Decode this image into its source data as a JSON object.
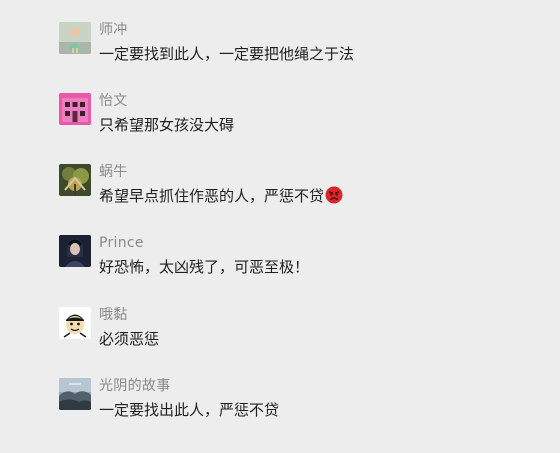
{
  "comments": [
    {
      "nickname": "师冲",
      "text": "一定要找到此人，一定要把他绳之于法",
      "avatar_icon": "child-photo-icon"
    },
    {
      "nickname": "怡文",
      "text": "只希望那女孩没大碍",
      "avatar_icon": "pink-house-icon"
    },
    {
      "nickname": "蜗牛",
      "text": "希望早点抓住作恶的人，严惩不贷",
      "avatar_icon": "tree-photo-icon",
      "emoji": "angry-face-icon"
    },
    {
      "nickname": "Prince",
      "text": "好恐怖，太凶残了，可恶至极！",
      "avatar_icon": "dark-portrait-icon"
    },
    {
      "nickname": "哦黏",
      "text": "必须恶惩",
      "avatar_icon": "cartoon-face-icon"
    },
    {
      "nickname": "光阴的故事",
      "text": "一定要找出此人，严惩不贷",
      "avatar_icon": "landscape-photo-icon"
    }
  ]
}
